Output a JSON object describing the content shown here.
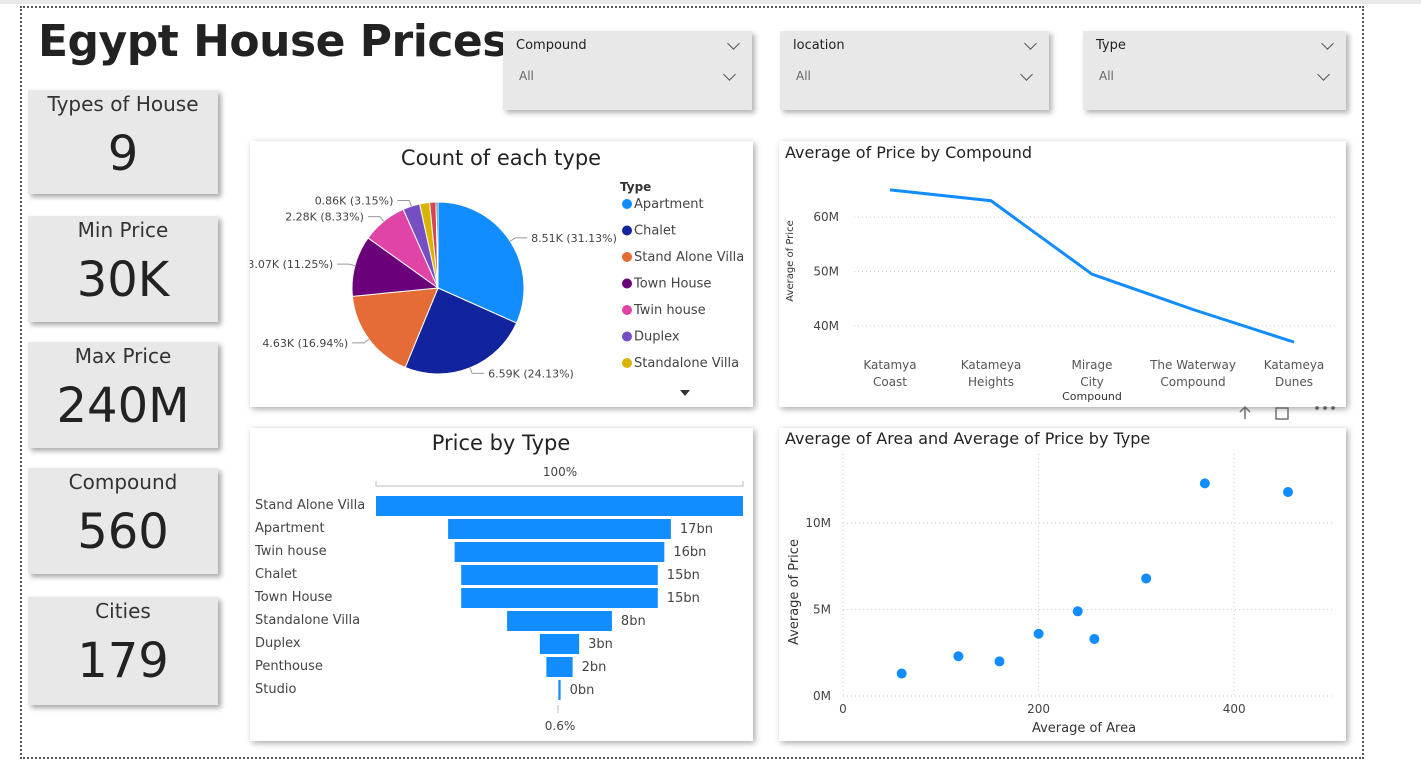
{
  "title": "Egypt House Prices",
  "cards": [
    {
      "label": "Types of House",
      "value": "9"
    },
    {
      "label": "Min Price",
      "value": "30K"
    },
    {
      "label": "Max Price",
      "value": "240M"
    },
    {
      "label": "Compound",
      "value": "560"
    },
    {
      "label": "Cities",
      "value": "179"
    }
  ],
  "slicers": [
    {
      "name": "Compound",
      "value": "All"
    },
    {
      "name": "location",
      "value": "All"
    },
    {
      "name": "Type",
      "value": "All"
    }
  ],
  "colors": {
    "accent": "#118DFF",
    "card_bg": "#e8e8e8"
  },
  "chart_data": [
    {
      "type": "pie",
      "title": "Count of each type",
      "legend_title": "Type",
      "legend_position": "right",
      "slices": [
        {
          "name": "Apartment",
          "value": 8510,
          "label": "8.51K (31.13%)",
          "color": "#118DFF"
        },
        {
          "name": "Chalet",
          "value": 6590,
          "label": "6.59K (24.13%)",
          "color": "#12239E"
        },
        {
          "name": "Stand Alone Villa",
          "value": 4630,
          "label": "4.63K (16.94%)",
          "color": "#E66C37"
        },
        {
          "name": "Town House",
          "value": 3070,
          "label": "3.07K (11.25%)",
          "color": "#6B007B"
        },
        {
          "name": "Twin house",
          "value": 2280,
          "label": "2.28K (8.33%)",
          "color": "#E044A7"
        },
        {
          "name": "Duplex",
          "value": 860,
          "label": "0.86K (3.15%)",
          "color": "#744EC2"
        },
        {
          "name": "Standalone Villa",
          "value": 500,
          "label": "",
          "color": "#D9B300"
        },
        {
          "name": "Penthouse",
          "value": 320,
          "label": "",
          "color": "#D64550"
        },
        {
          "name": "Studio",
          "value": 100,
          "label": "",
          "color": "#197278"
        }
      ],
      "legend_visible": [
        "Apartment",
        "Chalet",
        "Stand Alone Villa",
        "Town House",
        "Twin house",
        "Duplex",
        "Standalone Villa"
      ]
    },
    {
      "type": "line",
      "title": "Average of Price by Compound",
      "xlabel": "Compound",
      "ylabel": "Average of Price",
      "categories": [
        "Katamya Coast",
        "Katameya Heights",
        "Mirage City",
        "The Waterway Compound",
        "Katameya Dunes"
      ],
      "values": [
        65,
        63,
        49.5,
        43,
        37
      ],
      "ylim": [
        35,
        67
      ],
      "yticks": [
        40,
        50,
        60
      ],
      "ytick_labels": [
        "40M",
        "50M",
        "60M"
      ],
      "grid": true
    },
    {
      "type": "bar",
      "title": "Price by Type",
      "top_label": "100%",
      "bottom_label": "0.6%",
      "categories": [
        "Stand Alone Villa",
        "Apartment",
        "Twin house",
        "Chalet",
        "Town House",
        "Standalone Villa",
        "Duplex",
        "Penthouse",
        "Studio"
      ],
      "values": [
        28,
        17,
        16,
        15,
        15,
        8,
        3,
        2,
        0.17
      ],
      "labels": [
        "",
        "17bn",
        "16bn",
        "15bn",
        "15bn",
        "8bn",
        "3bn",
        "2bn",
        "0bn"
      ]
    },
    {
      "type": "scatter",
      "title": "Average of Area and Average of Price by Type",
      "xlabel": "Average of Area",
      "ylabel": "Average of Price",
      "xlim": [
        0,
        500
      ],
      "ylim": [
        0,
        14
      ],
      "xticks": [
        0,
        200,
        400
      ],
      "yticks": [
        0,
        5,
        10
      ],
      "ytick_labels": [
        "0M",
        "5M",
        "10M"
      ],
      "points": [
        {
          "x": 60,
          "y": 1.3
        },
        {
          "x": 118,
          "y": 2.3
        },
        {
          "x": 160,
          "y": 2.0
        },
        {
          "x": 200,
          "y": 3.6
        },
        {
          "x": 240,
          "y": 4.9
        },
        {
          "x": 257,
          "y": 3.3
        },
        {
          "x": 310,
          "y": 6.8
        },
        {
          "x": 370,
          "y": 12.3
        },
        {
          "x": 455,
          "y": 11.8
        }
      ],
      "grid": true
    }
  ]
}
